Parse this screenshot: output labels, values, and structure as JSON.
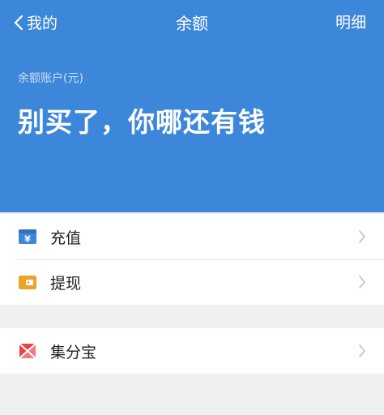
{
  "nav": {
    "back_label": "我的",
    "title": "余额",
    "detail_label": "明细"
  },
  "balance": {
    "label": "余额账户(元)",
    "value": "别买了，你哪还有钱"
  },
  "list_groups": [
    {
      "items": [
        {
          "label": "充值",
          "icon": "recharge-icon",
          "icon_color": "#3d87da"
        },
        {
          "label": "提现",
          "icon": "withdraw-wallet-icon",
          "icon_color": "#f0a12a"
        }
      ]
    },
    {
      "items": [
        {
          "label": "集分宝",
          "icon": "jifenbao-icon",
          "icon_color": "#e8434a"
        }
      ]
    }
  ],
  "colors": {
    "header_blue": "#3d87da",
    "background": "#eff0f2",
    "chevron": "#c7c7cc"
  }
}
